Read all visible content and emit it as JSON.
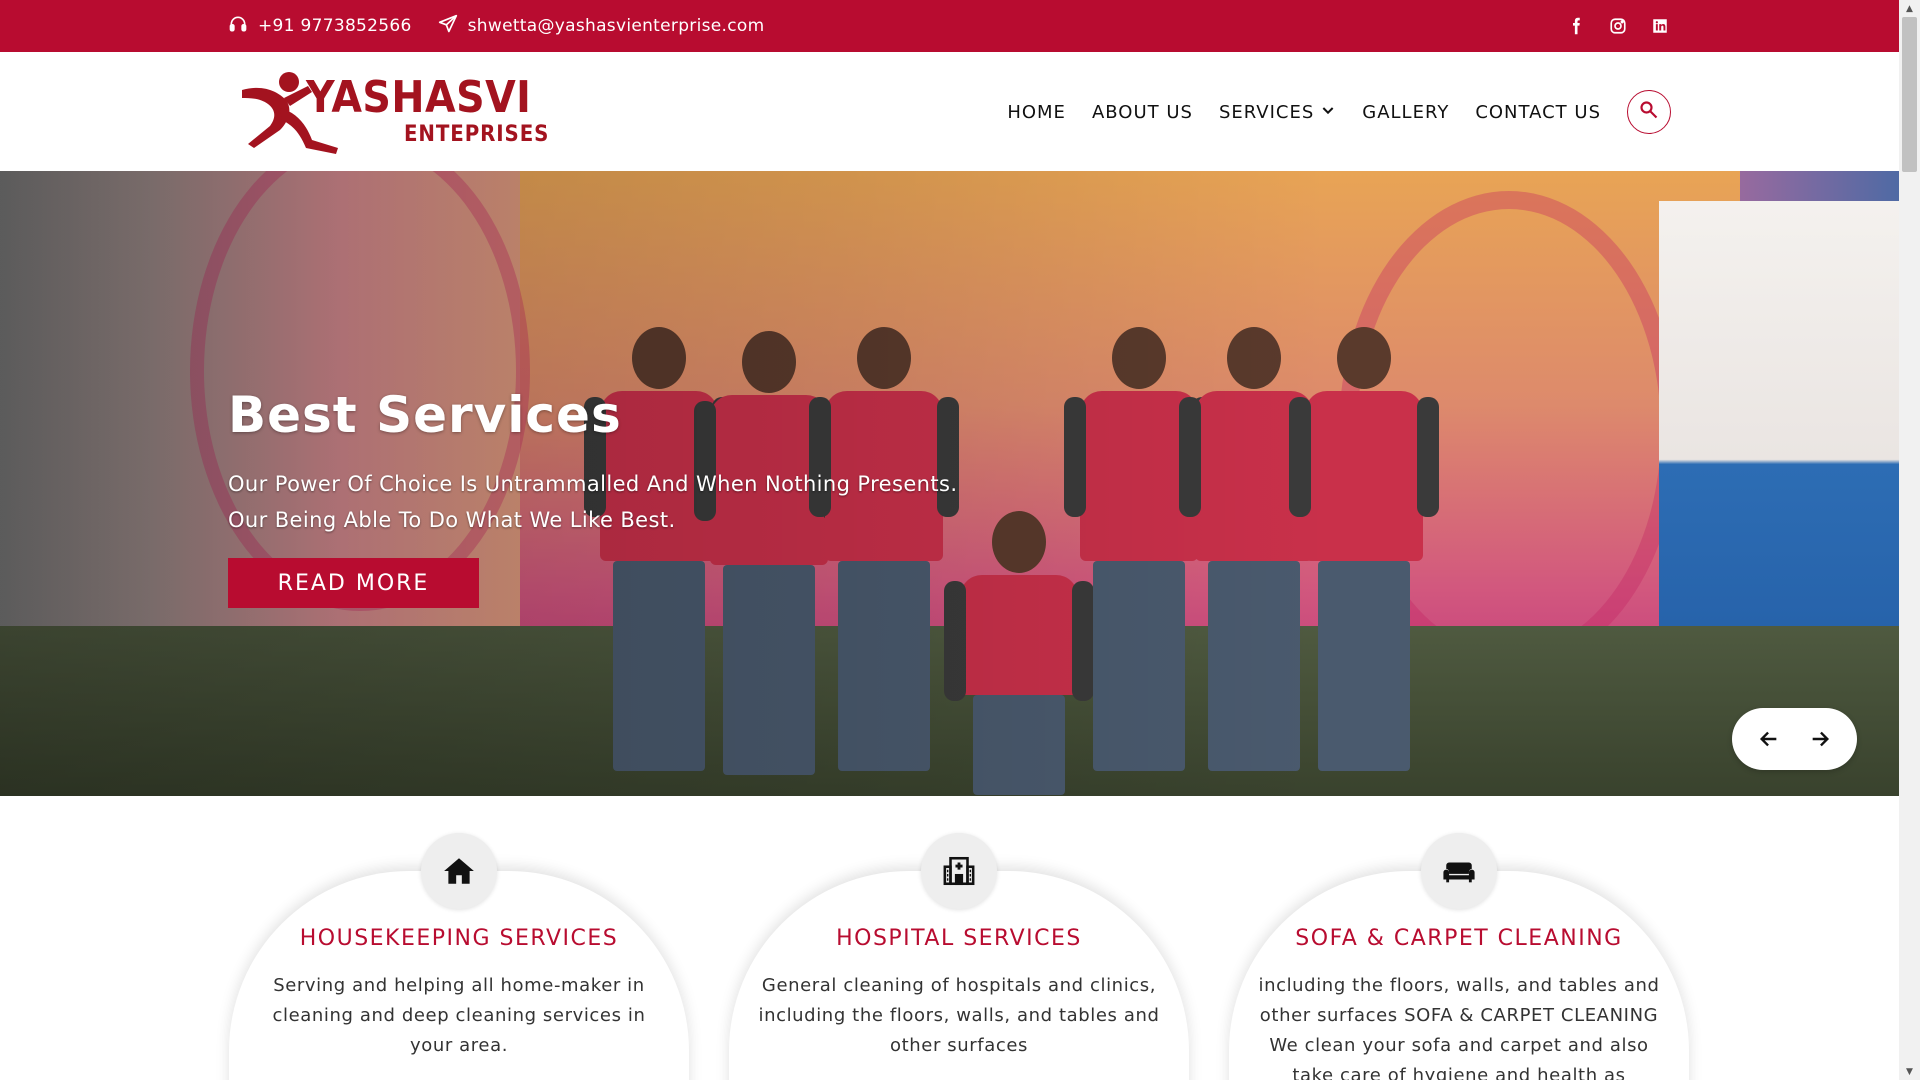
{
  "colors": {
    "brand": "#b80c30",
    "logo": "#a3131f",
    "text": "#222222"
  },
  "topbar": {
    "phone": "+91 9773852566",
    "phone_icon": "headset-icon",
    "email": "shwetta@yashasvienterprise.com",
    "email_icon": "paper-plane-icon",
    "social": [
      "facebook-icon",
      "instagram-icon",
      "linkedin-icon"
    ]
  },
  "header": {
    "logo_text": "YASHASVI",
    "logo_subtext": "ENTEPRISES",
    "nav": {
      "home": "HOME",
      "about": "ABOUT US",
      "services": "SERVICES",
      "gallery": "GALLERY",
      "contact": "CONTACT US"
    },
    "search_icon": "search-icon"
  },
  "hero": {
    "title": "Best  Services",
    "line1": "Our Power Of Choice Is Untrammalled And When Nothing Presents.",
    "line2": "Our Being Able To Do What We Like Best.",
    "button": "READ MORE",
    "prev_icon": "arrow-left-icon",
    "next_icon": "arrow-right-icon"
  },
  "services": [
    {
      "icon": "home-icon",
      "title": "HOUSEKEEPING SERVICES",
      "text": "Serving and helping all home-maker in cleaning and deep cleaning services in your area."
    },
    {
      "icon": "hospital-icon",
      "title": "HOSPITAL SERVICES",
      "text": "General cleaning of hospitals and clinics, including the floors, walls, and tables and other surfaces"
    },
    {
      "icon": "sofa-icon",
      "title": "SOFA & CARPET CLEANING",
      "text": "including the floors, walls, and tables and other surfaces SOFA & CARPET CLEANING We clean your sofa and carpet and also take care of hygiene and health as"
    }
  ]
}
